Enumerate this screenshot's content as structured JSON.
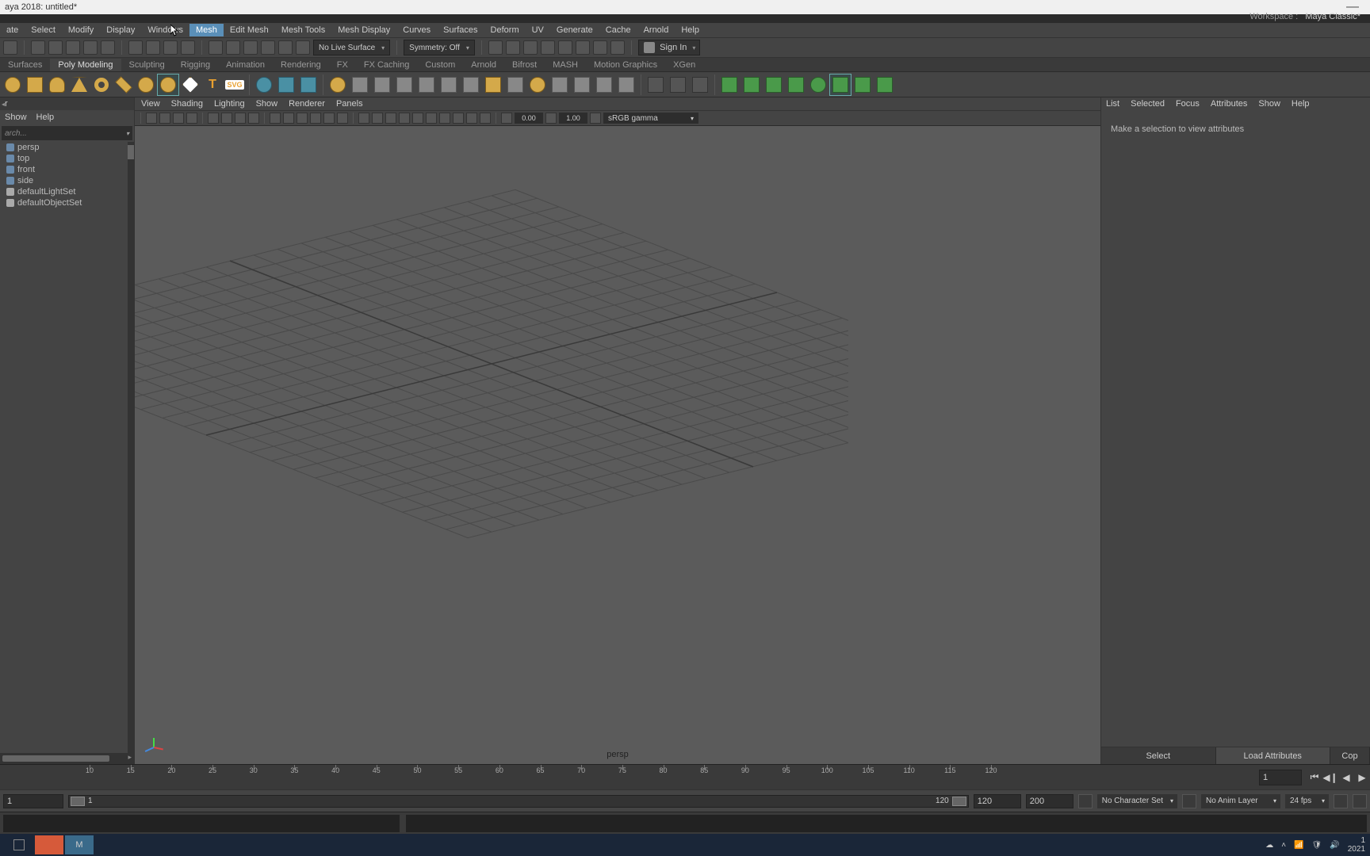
{
  "title": "aya 2018: untitled*",
  "workspace": {
    "label": "Workspace :",
    "value": "Maya Classic*"
  },
  "menubar": [
    "ate",
    "Select",
    "Modify",
    "Display",
    "Windows",
    "Mesh",
    "Edit Mesh",
    "Mesh Tools",
    "Mesh Display",
    "Curves",
    "Surfaces",
    "Deform",
    "UV",
    "Generate",
    "Cache",
    "Arnold",
    "Help"
  ],
  "menubar_active_index": 5,
  "toolbar": {
    "live_surface": "No Live Surface",
    "symmetry": "Symmetry: Off",
    "signin": "Sign In"
  },
  "module_tabs": [
    "Surfaces",
    "Poly Modeling",
    "Sculpting",
    "Rigging",
    "Animation",
    "Rendering",
    "FX",
    "FX Caching",
    "Custom",
    "Arnold",
    "Bifrost",
    "MASH",
    "Motion Graphics",
    "XGen"
  ],
  "module_active_index": 1,
  "outliner": {
    "menu": [
      "Show",
      "Help"
    ],
    "search_placeholder": "arch...",
    "items": [
      "persp",
      "top",
      "front",
      "side",
      "defaultLightSet",
      "defaultObjectSet"
    ]
  },
  "viewport": {
    "menu": [
      "View",
      "Shading",
      "Lighting",
      "Show",
      "Renderer",
      "Panels"
    ],
    "exposure": "0.00",
    "gamma": "1.00",
    "colorspace": "sRGB gamma",
    "camera": "persp"
  },
  "attr": {
    "menu": [
      "List",
      "Selected",
      "Focus",
      "Attributes",
      "Show",
      "Help"
    ],
    "empty_msg": "Make a selection to view attributes",
    "buttons": [
      "Select",
      "Load Attributes",
      "Cop"
    ]
  },
  "timeline": {
    "current": "1",
    "ticks": [
      10,
      15,
      20,
      25,
      30,
      35,
      40,
      45,
      50,
      55,
      60,
      65,
      70,
      75,
      80,
      85,
      90,
      95,
      100,
      105,
      110,
      115,
      120
    ]
  },
  "range": {
    "start_in": "1",
    "start_out": "1",
    "end_in": "120",
    "end_field": "120",
    "end_out": "200",
    "charset": "No Character Set",
    "animlayer": "No Anim Layer",
    "fps": "24 fps"
  },
  "help_tab": "✕",
  "taskbar": {
    "time": "1",
    "date": "2021"
  }
}
